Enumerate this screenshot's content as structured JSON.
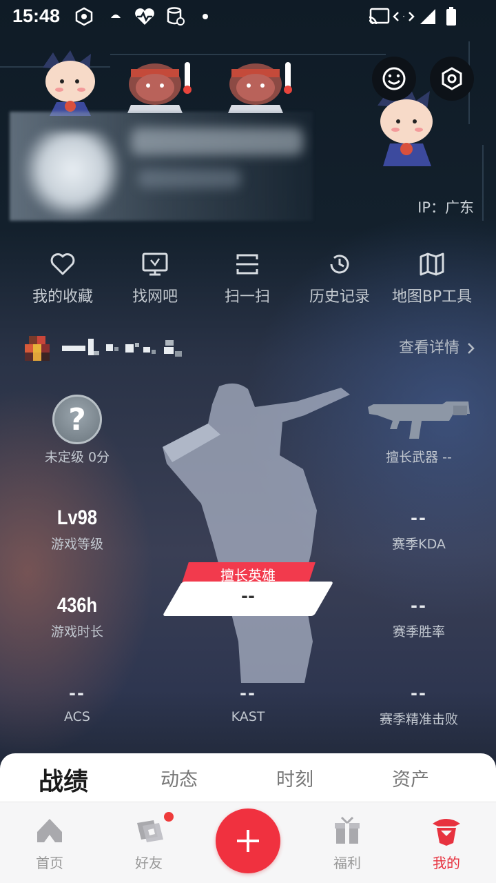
{
  "status_bar": {
    "time": "15:48"
  },
  "header": {
    "ip_label": "IP：广东"
  },
  "quick_actions": [
    {
      "label": "我的收藏",
      "icon": "heart-icon"
    },
    {
      "label": "找网吧",
      "icon": "monitor-icon"
    },
    {
      "label": "扫一扫",
      "icon": "scan-icon"
    },
    {
      "label": "历史记录",
      "icon": "history-icon"
    },
    {
      "label": "地图BP工具",
      "icon": "map-icon"
    }
  ],
  "account": {
    "detail_link": "查看详情"
  },
  "stats": {
    "rank": {
      "icon_text": "?",
      "label": "未定级 0分"
    },
    "weapon": {
      "label": "擅长武器 --"
    },
    "level": {
      "value": "Lv98",
      "label": "游戏等级"
    },
    "kda": {
      "value": "--",
      "label": "赛季KDA"
    },
    "playtime": {
      "value": "436h",
      "label": "游戏时长"
    },
    "winrate": {
      "value": "--",
      "label": "赛季胜率"
    },
    "acs": {
      "value": "--",
      "label": "ACS"
    },
    "kast": {
      "value": "--",
      "label": "KAST"
    },
    "first_kill": {
      "value": "--",
      "label": "赛季精准击败"
    },
    "hero": {
      "tag": "擅长英雄",
      "value": "--"
    }
  },
  "content_tabs": [
    "战绩",
    "动态",
    "时刻",
    "资产"
  ],
  "bottom_nav": [
    {
      "label": "首页",
      "icon": "home-icon"
    },
    {
      "label": "好友",
      "icon": "friends-icon"
    },
    {
      "label": "福利",
      "icon": "gift-icon"
    },
    {
      "label": "我的",
      "icon": "profile-icon"
    }
  ],
  "colors": {
    "accent": "#f0313f",
    "background": "#1a2433"
  }
}
